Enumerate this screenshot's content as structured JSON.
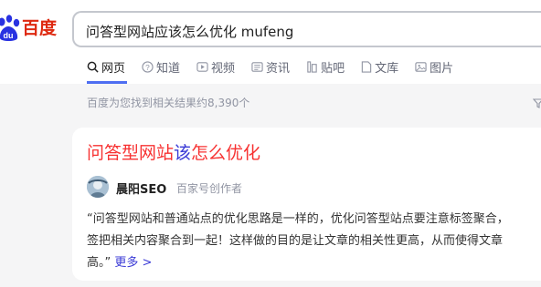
{
  "logo": {
    "text": "百度"
  },
  "search": {
    "query": "问答型网站应该怎么优化 mufeng"
  },
  "tabs": [
    {
      "label": "网页",
      "icon": "search-icon",
      "active": true
    },
    {
      "label": "知道",
      "icon": "question-icon"
    },
    {
      "label": "视频",
      "icon": "video-icon"
    },
    {
      "label": "资讯",
      "icon": "news-icon"
    },
    {
      "label": "贴吧",
      "icon": "tieba-icon"
    },
    {
      "label": "文库",
      "icon": "document-icon"
    },
    {
      "label": "图片",
      "icon": "image-icon"
    }
  ],
  "result_count": "百度为您找到相关结果约8,390个",
  "result": {
    "title_part1": "问答型网站",
    "title_part2": "该",
    "title_part3": "怎么优化",
    "author": "晨阳SEO",
    "author_tag": "百家号创作者",
    "snippet_line1": "“问答型网站和普通站点的优化思路是一样的，优化问答型站点要注意标签聚合，",
    "snippet_line2": "签把相关内容聚合到一起！这样做的目的是让文章的相关性更高，从而使得文章",
    "snippet_line3": "高。”",
    "more": "更多 >"
  },
  "colors": {
    "brand_red": "#de2910",
    "brand_blue": "#2932e1",
    "highlight": "#f73131",
    "link": "#3a3ad6",
    "tab_accent": "#4e6ef2"
  }
}
